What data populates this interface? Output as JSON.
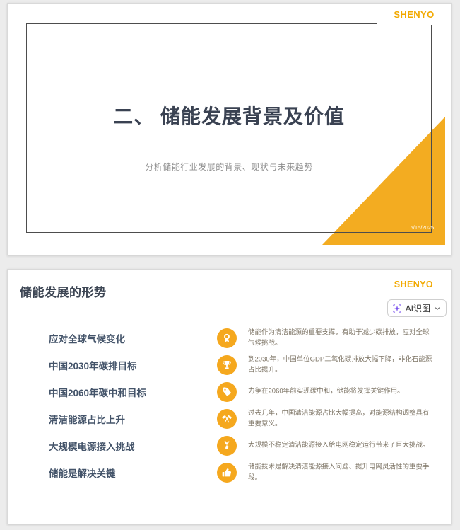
{
  "colors": {
    "accent_orange": "#F3AC21",
    "icon_orange": "#F5A81E",
    "logo_orange": "#F2A900",
    "title_navy": "#3A4252",
    "label_navy": "#44546A",
    "desc_gray": "#7E7566",
    "ai_icon_purple": "#7A52EE",
    "page_background": "#ececec"
  },
  "slide1": {
    "logo": "SHENYO",
    "title": "二、 储能发展背景及价值",
    "subtitle": "分析储能行业发展的背景、现状与未来趋势",
    "date": "5/15/2025"
  },
  "slide2": {
    "logo": "SHENYO",
    "title": "储能发展的形势",
    "ai_button": {
      "label": "AI识图",
      "leading_icon": "ai-sparkle-icon",
      "trailing_icon": "chevron-down-icon"
    },
    "rows": [
      {
        "label": "应对全球气候变化",
        "icon": "award-medal",
        "desc": "储能作为清洁能源的重要支撑，有助于减少碳排放，应对全球气候挑战。"
      },
      {
        "label": "中国2030年碳排目标",
        "icon": "trophy",
        "desc": "到2030年，中国单位GDP二氧化碳排放大幅下降，非化石能源占比提升。"
      },
      {
        "label": "中国2060年碳中和目标",
        "icon": "tag",
        "desc": "力争在2060年前实现碳中和，储能将发挥关键作用。"
      },
      {
        "label": "清洁能源占比上升",
        "icon": "crossed-flags",
        "desc": "过去几年，中国清洁能源占比大幅提高，对能源结构调整具有重要意义。"
      },
      {
        "label": "大规模电源接入挑战",
        "icon": "medal-star",
        "desc": "大规模不稳定清洁能源接入给电网稳定运行带来了巨大挑战。"
      },
      {
        "label": "储能是解决关键",
        "icon": "thumbs-up",
        "desc": "储能技术是解决清洁能源接入问题、提升电网灵活性的重要手段。"
      }
    ]
  }
}
